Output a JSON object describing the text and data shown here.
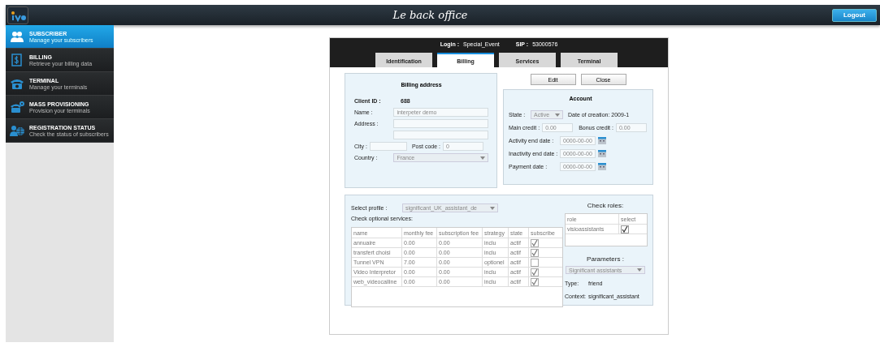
{
  "header": {
    "title": "Le back office",
    "logout": "Logout"
  },
  "sidebar": {
    "items": [
      {
        "kind": "users",
        "title": "SUBSCRIBER",
        "subtitle": "Manage your subscribers",
        "selected": true
      },
      {
        "kind": "bill",
        "title": "BILLING",
        "subtitle": "Retrieve your billing data",
        "selected": false
      },
      {
        "kind": "phone",
        "title": "TERMINAL",
        "subtitle": "Manage your terminals",
        "selected": false
      },
      {
        "kind": "phonegear",
        "title": "MASS PROVISIONING",
        "subtitle": "Provision your terminals",
        "selected": false
      },
      {
        "kind": "globe",
        "title": "REGISTRATION STATUS",
        "subtitle": "Check the status of subscribers",
        "selected": false
      }
    ]
  },
  "dialog": {
    "login_label": "Login :",
    "login": "Special_Event",
    "sip_label": "SIP :",
    "sip": "53000576",
    "tabs": [
      {
        "label": "Identification",
        "selected": false
      },
      {
        "label": "Billing",
        "selected": true
      },
      {
        "label": "Services",
        "selected": false
      },
      {
        "label": "Terminal",
        "selected": false
      }
    ],
    "billing_address": {
      "title": "Billing address",
      "client_id_label": "Client ID :",
      "client_id": "688",
      "name_label": "Name :",
      "name": "interpeter demo",
      "address_label": "Address :",
      "city_label": "City :",
      "postcode_label": "Post code :",
      "postcode": "0",
      "country_label": "Country :",
      "country": "France"
    },
    "buttons": [
      "Edit",
      "Close"
    ],
    "account": {
      "title": "Account",
      "state_label": "State :",
      "state": "Active",
      "creation": "Date of creation: 2009-1",
      "main_credit_label": "Main credit :",
      "main_credit": "0.00",
      "bonus_credit_label": "Bonus credit :",
      "bonus_credit": "0.00",
      "dates": [
        {
          "label": "Activity end date :",
          "value": "0000-00-00"
        },
        {
          "label": "Inactivity end date :",
          "value": "0000-00-00"
        },
        {
          "label": "Payment date :",
          "value": "0000-00-00"
        }
      ]
    },
    "profile_label": "Select profile :",
    "profile": "significant_UK_assistant_de",
    "services_label": "Check optional services:",
    "services": {
      "columns": [
        "name",
        "monthly fee",
        "subscription fee",
        "strategy",
        "state",
        "subscribe"
      ],
      "rows": [
        {
          "name": "annuaire",
          "monthly_fee": "0.00",
          "subscription_fee": "0.00",
          "strategy": "inclu",
          "state": "actif",
          "checked": true
        },
        {
          "name": "transfert choisi",
          "monthly_fee": "0.00",
          "subscription_fee": "0.00",
          "strategy": "inclu",
          "state": "actif",
          "checked": true
        },
        {
          "name": "Tunnel VPN",
          "monthly_fee": "7.00",
          "subscription_fee": "0.00",
          "strategy": "optionel",
          "state": "actif",
          "checked": false
        },
        {
          "name": "Video Interpretor",
          "monthly_fee": "0.00",
          "subscription_fee": "0.00",
          "strategy": "inclu",
          "state": "actif",
          "checked": true
        },
        {
          "name": "web_videocalline",
          "monthly_fee": "0.00",
          "subscription_fee": "0.00",
          "strategy": "inclu",
          "state": "actif",
          "checked": true
        }
      ]
    },
    "roles_title": "Check roles:",
    "roles": {
      "columns": [
        "role",
        "select"
      ],
      "rows": [
        {
          "role": "visioassistants",
          "checked": true
        }
      ]
    },
    "parameters_title": "Parameters :",
    "parameter": "Significant assistants",
    "type_label": "Type:",
    "type": "friend",
    "context_label": "Context:",
    "context": "significant_assistant"
  }
}
